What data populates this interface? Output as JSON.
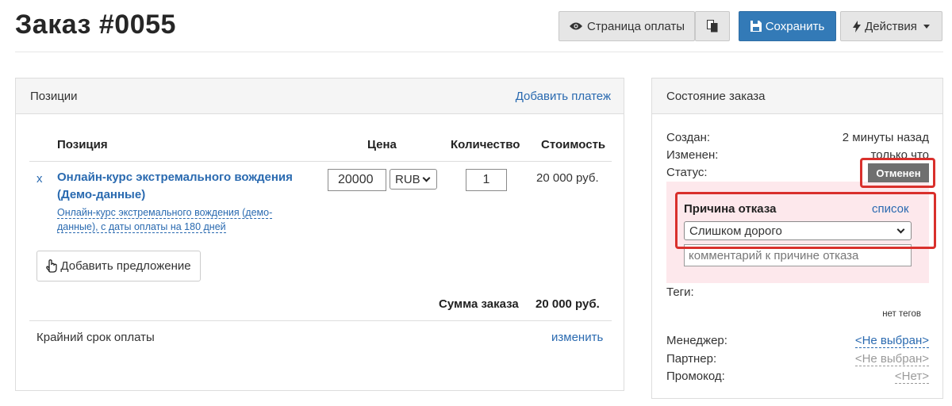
{
  "page": {
    "title": "Заказ #0055"
  },
  "toolbar": {
    "payment_page_label": "Страница оплаты",
    "save_label": "Сохранить",
    "actions_label": "Действия"
  },
  "positions_panel": {
    "heading": "Позиции",
    "add_payment_link": "Добавить платеж",
    "columns": {
      "position": "Позиция",
      "price": "Цена",
      "quantity": "Количество",
      "cost": "Стоимость"
    },
    "items": [
      {
        "remove": "x",
        "name_line1": "Онлайн-курс экстремального вождения",
        "name_line2": "(Демо-данные)",
        "desc_line1": "Онлайн-курс экстремального вождения (демо-",
        "desc_line2": "данные), с даты оплаты на 180 дней",
        "price": "20000",
        "currency": "RUB",
        "quantity": "1",
        "cost": "20 000 руб."
      }
    ],
    "add_offer_label": "Добавить предложение",
    "total_label": "Сумма заказа",
    "total_value": "20 000 руб.",
    "deadline_label": "Крайний срок оплаты",
    "change_link": "изменить"
  },
  "status_panel": {
    "heading": "Состояние заказа",
    "created_label": "Создан:",
    "created_value": "2 минуты назад",
    "modified_label": "Изменен:",
    "modified_value": "только что",
    "status_label": "Статус:",
    "status_value": "Отменен",
    "reason_label": "Причина отказа",
    "reason_list_link": "список",
    "reason_selected": "Слишком дорого",
    "comment_placeholder": "комментарий к причине отказа",
    "tags_label": "Теги:",
    "tags_value": "нет тегов",
    "manager_label": "Менеджер:",
    "manager_value": "<Не выбран>",
    "partner_label": "Партнер:",
    "partner_value": "<Не выбран>",
    "promo_label": "Промокод:",
    "promo_value": "<Нет>"
  },
  "colors": {
    "primary": "#337ab7",
    "link": "#2a6ab0",
    "highlight": "#d9302c",
    "reason_bg": "#fde8ec",
    "badge": "#6f6f6f"
  }
}
